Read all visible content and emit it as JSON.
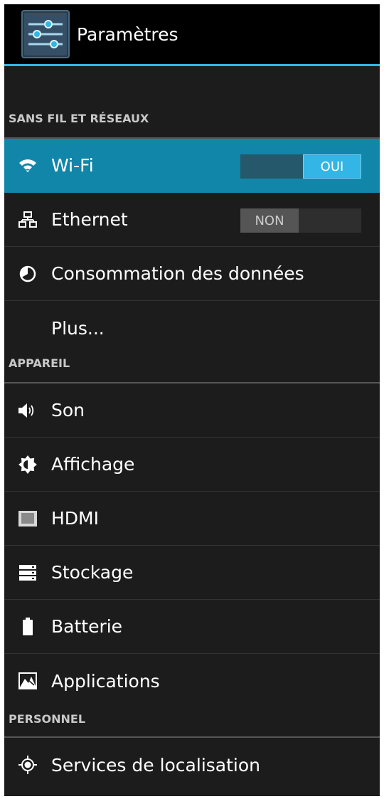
{
  "actionbar": {
    "title": "Paramètres",
    "icon": "settings-sliders-icon"
  },
  "sections": {
    "wireless": "SANS FIL ET RÉSEAUX",
    "device": "APPAREIL",
    "personal": "PERSONNEL"
  },
  "items": {
    "wifi": {
      "label": "Wi-Fi",
      "toggle": "OUI",
      "icon": "wifi-icon",
      "state": "on"
    },
    "ethernet": {
      "label": "Ethernet",
      "toggle": "NON",
      "icon": "ethernet-icon",
      "state": "off"
    },
    "data_usage": {
      "label": "Consommation des données",
      "icon": "data-usage-icon"
    },
    "more": {
      "label": "Plus..."
    },
    "sound": {
      "label": "Son",
      "icon": "speaker-icon"
    },
    "display": {
      "label": "Affichage",
      "icon": "brightness-icon"
    },
    "hdmi": {
      "label": "HDMI",
      "icon": "hdmi-icon"
    },
    "storage": {
      "label": "Stockage",
      "icon": "storage-icon"
    },
    "battery": {
      "label": "Batterie",
      "icon": "battery-icon"
    },
    "apps": {
      "label": "Applications",
      "icon": "applications-icon"
    },
    "location": {
      "label": "Services de localisation",
      "icon": "location-icon"
    }
  },
  "colors": {
    "accent": "#33b5e5",
    "selected_row": "#1286a8",
    "background": "#1c1c1c"
  }
}
